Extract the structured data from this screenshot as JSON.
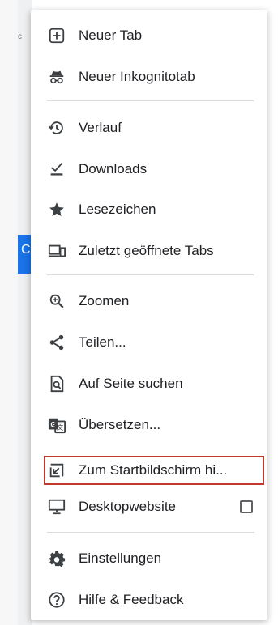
{
  "menu": {
    "items": [
      {
        "label": "Neuer Tab",
        "icon": "new-tab-icon"
      },
      {
        "label": "Neuer Inkognitotab",
        "icon": "incognito-icon"
      },
      {
        "label": "Verlauf",
        "icon": "history-icon"
      },
      {
        "label": "Downloads",
        "icon": "download-icon"
      },
      {
        "label": "Lesezeichen",
        "icon": "star-icon"
      },
      {
        "label": "Zuletzt geöffnete Tabs",
        "icon": "recent-tabs-icon"
      },
      {
        "label": "Zoomen",
        "icon": "zoom-icon"
      },
      {
        "label": "Teilen...",
        "icon": "share-icon"
      },
      {
        "label": "Auf Seite suchen",
        "icon": "find-in-page-icon"
      },
      {
        "label": "Übersetzen...",
        "icon": "translate-icon"
      },
      {
        "label": "Zum Startbildschirm hi...",
        "icon": "add-to-home-icon"
      },
      {
        "label": "Desktopwebsite",
        "icon": "desktop-icon",
        "checked": false
      },
      {
        "label": "Einstellungen",
        "icon": "gear-icon"
      },
      {
        "label": "Hilfe & Feedback",
        "icon": "help-icon"
      }
    ]
  },
  "background": {
    "fragment_top": "c",
    "fragment_bar": "C"
  },
  "colors": {
    "text": "#202124",
    "icon": "#3c4043",
    "highlight_border": "#c0392b",
    "divider": "#dadce0",
    "accent": "#1a73e8"
  }
}
